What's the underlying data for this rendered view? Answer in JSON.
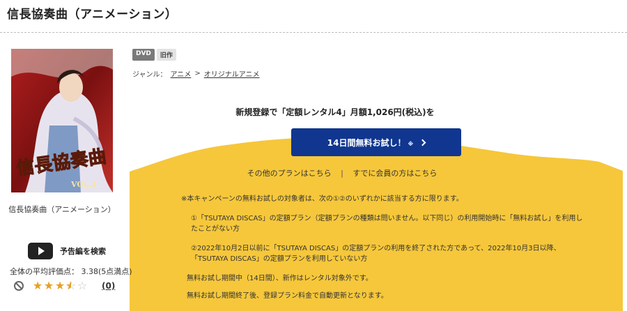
{
  "page": {
    "title": "信長協奏曲（アニメーション）"
  },
  "product": {
    "cover_alt": "信長協奏曲",
    "cover_text": "信長協奏曲",
    "cover_vol": "VOL.1",
    "caption": "信長協奏曲（アニメーション）",
    "trailer_label": "予告編を検索",
    "rating_text": "全体の平均評価点： 3.38(5点満点)",
    "rating_value": 3.38,
    "rating_max": 5,
    "review_count": "(0)"
  },
  "badges": [
    "DVD",
    "旧作"
  ],
  "genre": {
    "label": "ジャンル：",
    "items": [
      "アニメ",
      "オリジナルアニメ"
    ],
    "separator": ">"
  },
  "campaign": {
    "headline": "新規登録で「定額レンタル4」月額1,026円(税込)を",
    "cta_label": "14日間無料お試し！",
    "cta_note": "※",
    "other_plans": "その他のプランはこちら",
    "separator": "|",
    "members": "すでに会員の方はこちら",
    "notes": [
      "※本キャンペーンの無料お試しの対象者は、次の①②のいずれかに該当する方に限ります。",
      "①「TSUTAYA DISCAS」の定額プラン（定額プランの種類は問いません。以下同じ）の利用開始時に「無料お試し」を利用したことがない方",
      "②2022年10月2日以前に「TSUTAYA DISCAS」の定額プランの利用を終了された方であって、2022年10月3日以降、「TSUTAYA DISCAS」の定額プランを利用していない方",
      "無料お試し期間中（14日間）、新作はレンタル対象外です。",
      "無料お試し期間終了後、登録プラン料金で自動更新となります。"
    ]
  },
  "colors": {
    "yellow": "#f6c73b",
    "cta_blue": "#10368f",
    "star": "#e8a020",
    "cover_red": "#8e1b1b"
  },
  "icons": [
    "play-icon",
    "no-icon",
    "star-icon",
    "chevron-right-icon"
  ]
}
